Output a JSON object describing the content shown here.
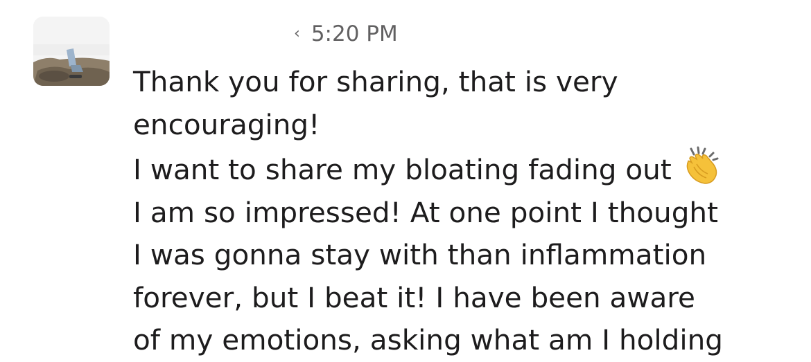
{
  "message": {
    "timestamp": "5:20 PM",
    "timestamp_prefix_glyph": "‹",
    "avatar_icon": "user-photo-avatar",
    "lines": [
      "Thank you for sharing, that is very",
      "encouraging!",
      "I want to share my bloating fading out",
      "I am so impressed! At one point I thought",
      "I was gonna stay with than inflammation",
      "forever, but I beat it! I have been aware",
      "of my emotions, asking what am I holding"
    ],
    "emoji": "clapping-hands-icon"
  },
  "colors": {
    "text": "#1d1c1d",
    "muted": "#616061",
    "background": "#ffffff",
    "emoji_skin": "#f5c13a"
  }
}
